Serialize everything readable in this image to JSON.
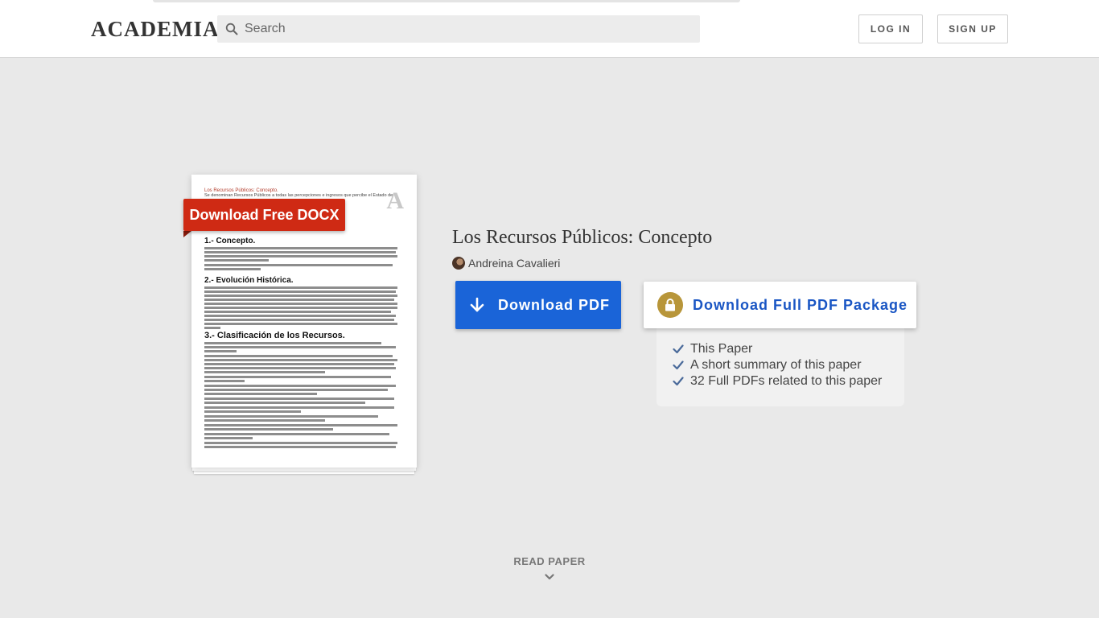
{
  "header": {
    "logo": "ACADEMIA",
    "search_placeholder": "Search",
    "login_label": "LOG IN",
    "signup_label": "SIGN UP"
  },
  "preview": {
    "docx_label": "Download Free DOCX",
    "watermark": "A",
    "small_title": "Los Recursos Públicos: Concepto.",
    "small_subtitle": "Se denominan Recursos Públicos a todas las percepciones e ingresos que percibe el Estado de",
    "headings": [
      "1.- Concepto.",
      "2.- Evolución Histórica.",
      "3.- Clasificación de los Recursos."
    ]
  },
  "paper": {
    "title": "Los Recursos Públicos: Concepto",
    "author": "Andreina Cavalieri"
  },
  "actions": {
    "download_pdf_label": "Download PDF",
    "download_package_label": "Download Full PDF Package",
    "features": [
      "This Paper",
      "A short summary of this paper",
      "32 Full PDFs related to this paper"
    ]
  },
  "footer": {
    "read_paper_label": "READ PAPER"
  },
  "colors": {
    "pdf_button": "#1a64d8",
    "docx_badge": "#cf2a14",
    "lock_gold": "#b8963a",
    "package_text": "#1a56c4",
    "check": "#4a6a9a"
  },
  "icons": [
    "search-icon",
    "download-arrow-icon",
    "lock-icon",
    "check-icon",
    "chevron-down-icon"
  ]
}
